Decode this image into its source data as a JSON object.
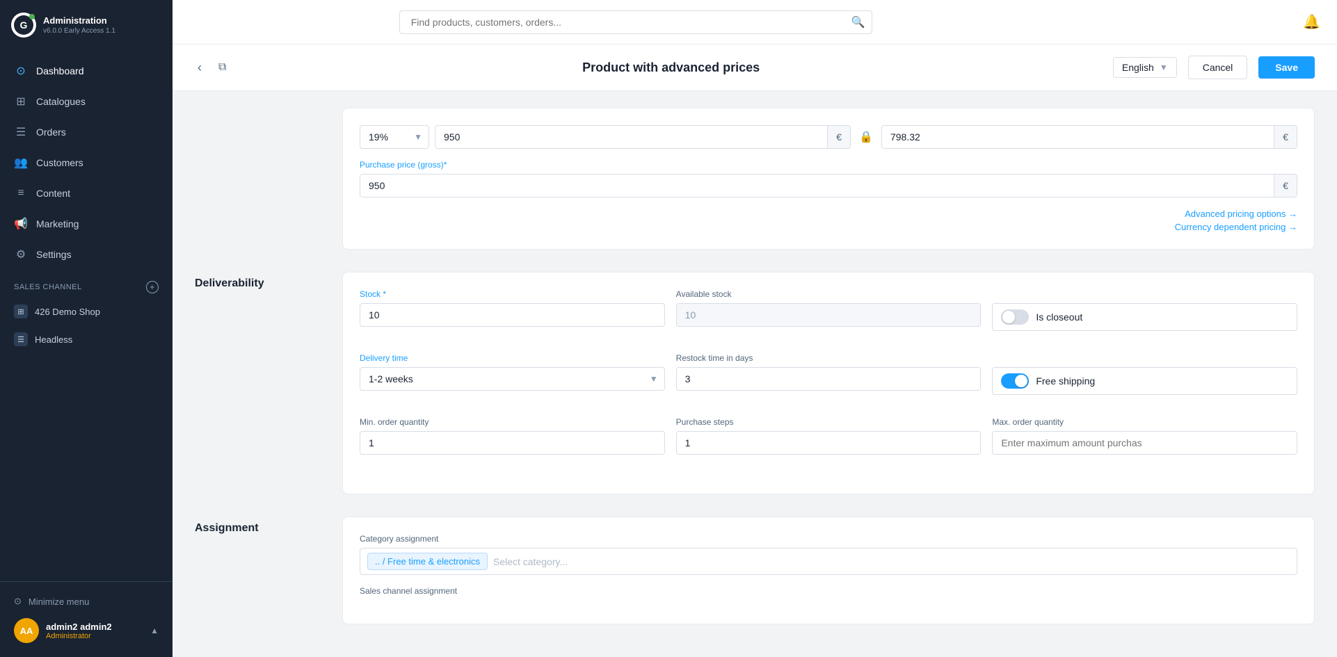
{
  "app": {
    "name": "Administration",
    "version": "v6.0.0 Early Access 1.1",
    "online_indicator": "online"
  },
  "sidebar": {
    "nav_items": [
      {
        "id": "dashboard",
        "label": "Dashboard",
        "icon": "⊙"
      },
      {
        "id": "catalogues",
        "label": "Catalogues",
        "icon": "⊞"
      },
      {
        "id": "orders",
        "label": "Orders",
        "icon": "☰"
      },
      {
        "id": "customers",
        "label": "Customers",
        "icon": "👥"
      },
      {
        "id": "content",
        "label": "Content",
        "icon": "≡"
      },
      {
        "id": "marketing",
        "label": "Marketing",
        "icon": "📢"
      },
      {
        "id": "settings",
        "label": "Settings",
        "icon": "⚙"
      }
    ],
    "sales_channel_section": "Sales channel",
    "sales_channels": [
      {
        "id": "426-demo-shop",
        "label": "426 Demo Shop",
        "icon": "⊞"
      },
      {
        "id": "headless",
        "label": "Headless",
        "icon": "☰"
      }
    ],
    "minimize_label": "Minimize menu",
    "user": {
      "initials": "AA",
      "name": "admin2 admin2",
      "role": "Administrator"
    }
  },
  "topbar": {
    "search_placeholder": "Find products, customers, orders...",
    "notification_icon": "🔔"
  },
  "page_header": {
    "title": "Product with advanced prices",
    "language": "English",
    "cancel_label": "Cancel",
    "save_label": "Save"
  },
  "pricing_section": {
    "tax_rate": "19%",
    "gross_price": "950",
    "gross_currency": "€",
    "net_price": "798.32",
    "net_currency": "€",
    "purchase_price_label": "Purchase price (gross)*",
    "purchase_price": "950",
    "purchase_currency": "€",
    "advanced_pricing_link": "Advanced pricing options →",
    "currency_pricing_link": "Currency dependent pricing →"
  },
  "deliverability": {
    "section_label": "Deliverability",
    "stock_label": "Stock *",
    "stock_value": "10",
    "available_stock_label": "Available stock",
    "available_stock_value": "10",
    "is_closeout_label": "Is closeout",
    "delivery_time_label": "Delivery time",
    "delivery_time_value": "1-2 weeks",
    "restock_time_label": "Restock time in days",
    "restock_time_value": "3",
    "free_shipping_label": "Free shipping",
    "free_shipping_enabled": true,
    "min_order_label": "Min. order quantity",
    "min_order_value": "1",
    "purchase_steps_label": "Purchase steps",
    "purchase_steps_value": "1",
    "max_order_label": "Max. order quantity",
    "max_order_placeholder": "Enter maximum amount purchas"
  },
  "assignment": {
    "section_label": "Assignment",
    "category_assignment_label": "Category assignment",
    "category_tag": ".. / Free time & electronics",
    "category_placeholder": "Select category...",
    "sales_channel_label": "Sales channel assignment"
  }
}
